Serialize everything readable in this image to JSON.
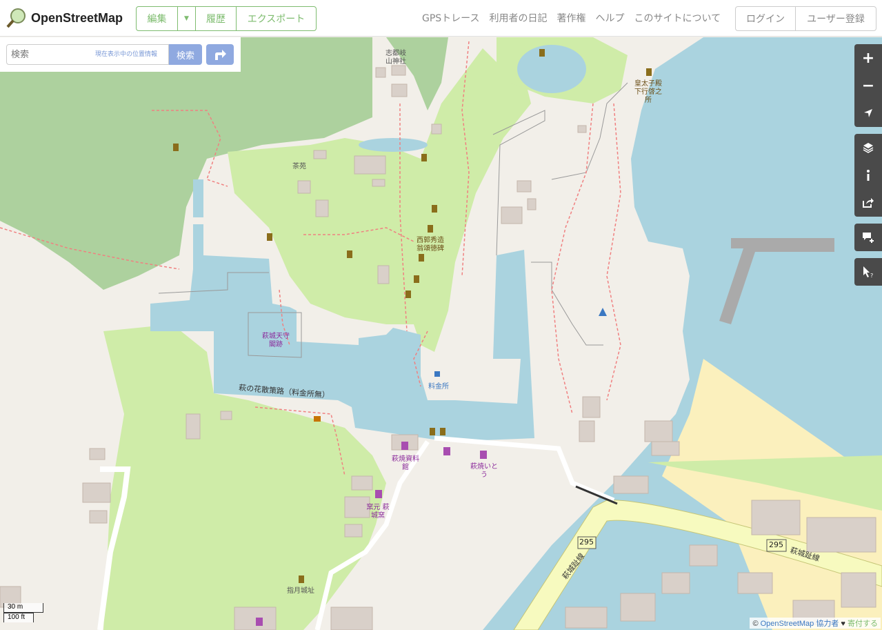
{
  "header": {
    "logo_text": "OpenStreetMap",
    "edit_label": "編集",
    "history_label": "履歴",
    "export_label": "エクスポート",
    "nav": [
      "GPSトレース",
      "利用者の日記",
      "著作権",
      "ヘルプ",
      "このサイトについて"
    ],
    "login_label": "ログイン",
    "signup_label": "ユーザー登録"
  },
  "search": {
    "placeholder": "検索",
    "where_am_i": "現在表示中の位置情報",
    "submit_label": "検索"
  },
  "map": {
    "labels": {
      "shrine": "志都岐山神社",
      "tea": "茶苑",
      "monument": "西郭秀造翁頌徳碑",
      "castle": "萩城天守閣跡",
      "promenade": "萩の花散策路（料金所無）",
      "toll": "料金所",
      "museum": "萩焼資料館",
      "shop": "萩焼いとう",
      "kiln": "窯元 萩城窯",
      "ruins": "指月城址",
      "prince": "皇太子殿下行啓之所",
      "road_num": "295",
      "road_name": "萩城趾線"
    }
  },
  "scale": {
    "metric": "30 m",
    "imperial": "100 ft"
  },
  "attribution": {
    "prefix": "©",
    "link": "OpenStreetMap",
    "contributors": "協力者",
    "heart": "♥",
    "donate": "寄付する"
  },
  "colors": {
    "water": "#aad3df",
    "park": "#c8facc",
    "forest": "#add19e",
    "building": "#d9d0c9",
    "sand": "#fff1ba",
    "accent": "#7ebc6f",
    "search_blue": "#8fa9e0"
  }
}
